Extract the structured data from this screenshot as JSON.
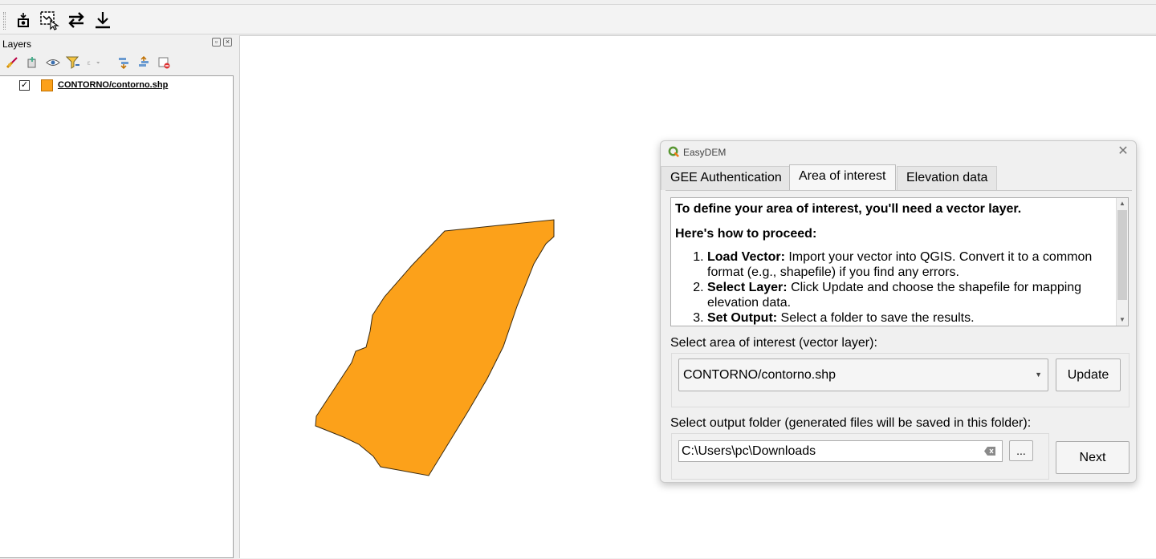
{
  "toolbar": {
    "items": [
      {
        "icon": "camera-icon"
      },
      {
        "icon": "select-map-area-icon"
      },
      {
        "icon": "swap-arrows-icon"
      },
      {
        "icon": "download-icon"
      }
    ]
  },
  "layers_panel": {
    "title": "Layers",
    "tools": [
      "style-brush-icon",
      "add-group-icon",
      "visibility-eye-icon",
      "filter-icon",
      "expression-filter-icon",
      "expand-all-icon",
      "collapse-all-icon",
      "remove-layer-icon"
    ],
    "layers": [
      {
        "name": "CONTORNO/contorno.shp",
        "checked": true,
        "color": "#fca11a"
      }
    ]
  },
  "map": {
    "polygon_fill": "#fca11a",
    "polygon_stroke": "#3a2a10"
  },
  "dialog": {
    "title": "EasyDEM",
    "tabs": [
      {
        "label": "GEE Authentication",
        "active": false
      },
      {
        "label": "Area of interest",
        "active": true
      },
      {
        "label": "Elevation data",
        "active": false
      }
    ],
    "instructions": {
      "heading": "To define your area of interest, you'll need a vector layer.",
      "subheading": "Here's how to proceed:",
      "steps": [
        {
          "title": "Load Vector:",
          "text": "Import your vector into QGIS. Convert it to a common format (e.g., shapefile) if you find any errors."
        },
        {
          "title": "Select Layer:",
          "text": "Click Update and choose the shapefile for mapping elevation data."
        },
        {
          "title": "Set Output:",
          "text": "Select a folder to save the results."
        }
      ]
    },
    "aoi_label": "Select area of interest (vector layer):",
    "aoi_value": "CONTORNO/contorno.shp",
    "update_label": "Update",
    "output_label": "Select output folder (generated files will be saved in this folder):",
    "output_path": "C:\\Users\\pc\\Downloads",
    "browse_label": "...",
    "next_label": "Next"
  }
}
